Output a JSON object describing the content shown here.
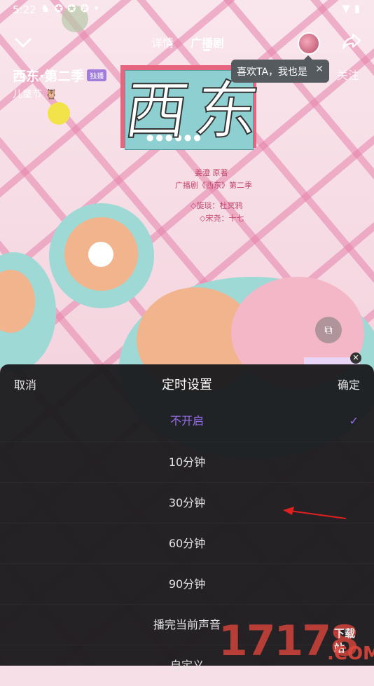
{
  "status_bar": {
    "time": "5:22",
    "notification_icons": [
      "notification-icon",
      "app-icon",
      "app-icon",
      "app-icon",
      "dot-icon"
    ],
    "right_icons": [
      "wifi-icon",
      "battery-icon"
    ]
  },
  "top_nav": {
    "tabs": [
      {
        "label": "详情",
        "active": false
      },
      {
        "label": "广播剧",
        "active": true
      }
    ]
  },
  "drama": {
    "title": "西东·第二季",
    "badge": "独播",
    "subtitle": "儿童节"
  },
  "tooltip": {
    "text": "喜欢TA，我也是"
  },
  "follow_faded": "关注",
  "cover": {
    "calligraphy": "西东",
    "dots": "●●●●●●",
    "credits": [
      "姜澄 原著",
      "广播剧《西东》第二季",
      "◇旋琰：杜冥鸦",
      "◇宋尧：十七"
    ]
  },
  "sheet": {
    "cancel_label": "取消",
    "title": "定时设置",
    "confirm_label": "确定",
    "options": [
      {
        "label": "不开启",
        "selected": true
      },
      {
        "label": "10分钟",
        "selected": false
      },
      {
        "label": "30分钟",
        "selected": false
      },
      {
        "label": "60分钟",
        "selected": false
      },
      {
        "label": "90分钟",
        "selected": false
      },
      {
        "label": "播完当前声音",
        "selected": false
      },
      {
        "label": "自定义",
        "selected": false
      }
    ],
    "check_mark": "✓"
  },
  "watermark": {
    "number": "17178",
    "site": "下载站",
    "domain": ".COM"
  },
  "colors": {
    "accent": "#9a6cf0",
    "sheet_bg": "#1b1b1d",
    "arrow": "#e02020"
  }
}
